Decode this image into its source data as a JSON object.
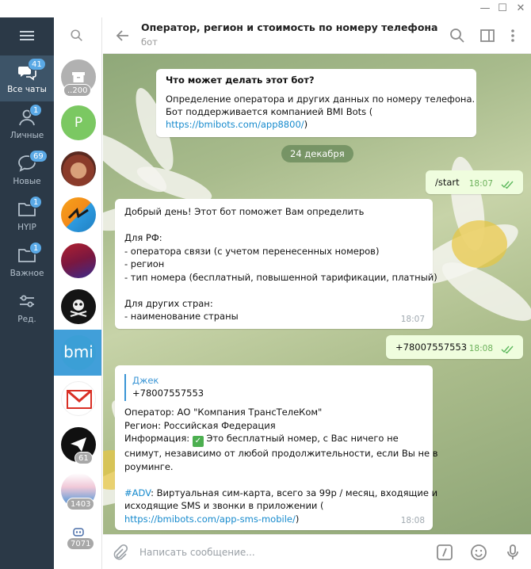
{
  "window": {
    "minimize_glyph": "—",
    "maximize_glyph": "☐",
    "close_glyph": "✕"
  },
  "folders": [
    {
      "label": "Все чаты",
      "badge": "41",
      "icon": "chats-icon",
      "active": true
    },
    {
      "label": "Личные",
      "badge": "1",
      "icon": "person-icon",
      "active": false
    },
    {
      "label": "Новые",
      "badge": "69",
      "icon": "chat-bubble-icon",
      "active": false
    },
    {
      "label": "HYIP",
      "badge": "1",
      "icon": "folder-icon",
      "active": false
    },
    {
      "label": "Важное",
      "badge": "1",
      "icon": "folder-icon",
      "active": false
    },
    {
      "label": "Ред.",
      "badge": "",
      "icon": "sliders-icon",
      "active": false
    }
  ],
  "chats": [
    {
      "avatar": "archive-avatar",
      "badge": "..200",
      "initial": ""
    },
    {
      "avatar": "letter-avatar",
      "badge": "",
      "initial": "P"
    },
    {
      "avatar": "photo-avatar",
      "badge": "",
      "initial": ""
    },
    {
      "avatar": "logo-avatar",
      "badge": "",
      "initial": ""
    },
    {
      "avatar": "logo-avatar",
      "badge": "",
      "initial": ""
    },
    {
      "avatar": "pirate-avatar",
      "badge": "",
      "initial": ""
    },
    {
      "avatar": "bmi-avatar",
      "badge": "",
      "initial": "bmi"
    },
    {
      "avatar": "mail-avatar",
      "badge": "",
      "initial": ""
    },
    {
      "avatar": "arrow-avatar",
      "badge": "61",
      "initial": ""
    },
    {
      "avatar": "banner-avatar",
      "badge": "1403",
      "initial": ""
    },
    {
      "avatar": "bot-avatar",
      "badge": "7071",
      "initial": ""
    }
  ],
  "header": {
    "title": "Оператор, регион и стоимость по номеру телефона",
    "subtitle": "бот"
  },
  "messages": {
    "bot_info": {
      "title": "Что может делать этот бот?",
      "line1": "Определение оператора и других данных по номеру телефона.",
      "line2": "Бот поддерживается компанией BMI Bots (",
      "link": "https://bmibots.com/app8800/",
      "link_suffix": ")"
    },
    "date_separator": "24 декабря",
    "start": {
      "text": "/start",
      "time": "18:07"
    },
    "greeting": {
      "lines": [
        "Добрый день! Этот бот поможет Вам определить",
        "",
        "Для РФ:",
        "- оператора связи (с учетом перенесенных номеров)",
        "- регион",
        "- тип номера (бесплатный, повышенной тарификации, платный)",
        "",
        "Для других стран:",
        "- наименование страны"
      ],
      "time": "18:07"
    },
    "phone": {
      "text": "+78007557553",
      "time": "18:08"
    },
    "result": {
      "reply_name": "Джек",
      "reply_text": "+78007557553",
      "operator": "Оператор: АО \"Компания ТрансТелеКом\"",
      "region": "Регион: Российская Федерация",
      "info_prefix": "Информация: ",
      "info_emoji": "✓",
      "info_line1": " Это бесплатный номер, с Вас ничего не",
      "info_line2": "снимут, независимо от любой продолжительности, если Вы не в",
      "info_line3": "роуминге.",
      "adv_tag": "#ADV",
      "adv_line1": ": Виртуальная сим-карта, всего за 99р / месяц, входящие и",
      "adv_line2": "исходящие SMS и звонки в приложении (",
      "adv_link": "https://bmibots.com/app-sms-mobile/",
      "adv_suffix": ")",
      "time": "18:08"
    }
  },
  "compose": {
    "placeholder": "Написать сообщение..."
  },
  "colors": {
    "sidebar": "#2b3947",
    "accent": "#419fd9",
    "outgoing": "#effdde",
    "badge": "#5aa9e6"
  }
}
